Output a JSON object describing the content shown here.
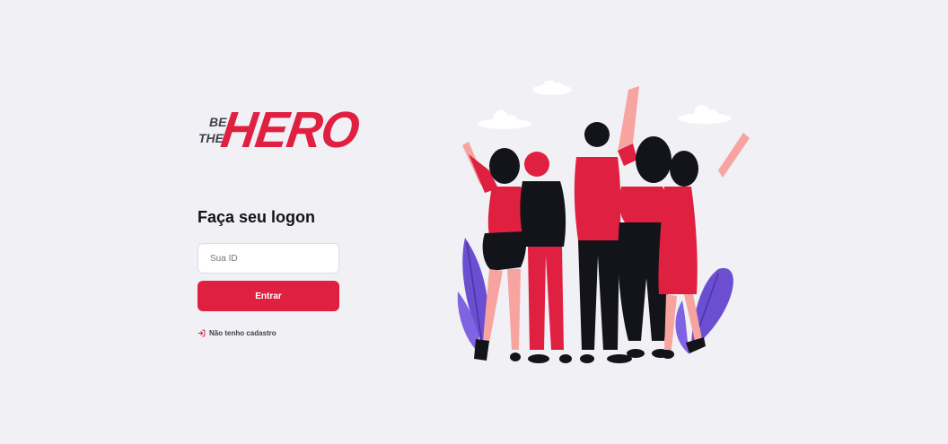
{
  "logo": {
    "small_line1": "BE",
    "small_line2": "THE",
    "main": "HERO"
  },
  "logon": {
    "title": "Faça seu logon",
    "id_placeholder": "Sua ID",
    "submit_label": "Entrar",
    "register_link": "Não tenho cadastro"
  },
  "icons": {
    "register_link_icon": "log-in-icon"
  },
  "colors": {
    "brand": "#e02041",
    "background": "#f0f0f5",
    "text": "#13131a"
  }
}
